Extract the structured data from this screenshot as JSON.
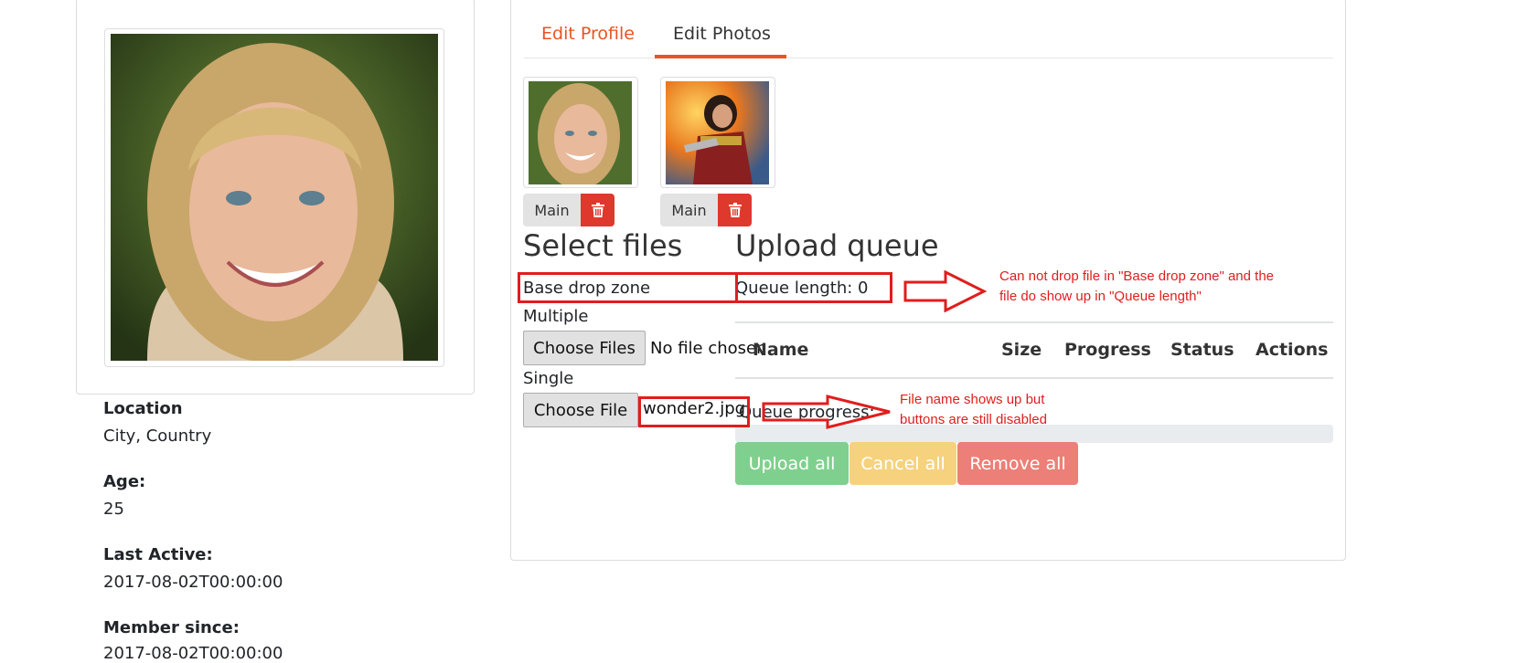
{
  "profile": {
    "location_label": "Location",
    "location_value": "City, Country",
    "age_label": "Age:",
    "age_value": "25",
    "last_active_label": "Last Active:",
    "last_active_value": "2017-08-02T00:00:00",
    "member_since_label": "Member since:",
    "member_since_value": "2017-08-02T00:00:00"
  },
  "tabs": {
    "edit_profile": "Edit Profile",
    "edit_photos": "Edit Photos"
  },
  "photos": [
    {
      "main_label": "Main",
      "delete_icon": "trash-icon"
    },
    {
      "main_label": "Main",
      "delete_icon": "trash-icon"
    }
  ],
  "select_files": {
    "heading": "Select files",
    "drop_zone": "Base drop zone",
    "multiple_label": "Multiple",
    "multiple_button": "Choose Files",
    "multiple_status": "No file chosen",
    "single_label": "Single",
    "single_button": "Choose File",
    "single_status": "wonder2.jpg"
  },
  "upload_queue": {
    "heading": "Upload queue",
    "queue_length": "Queue length: 0",
    "columns": [
      "Name",
      "Size",
      "Progress",
      "Status",
      "Actions"
    ],
    "progress_label": "Queue progress:",
    "progress": 0,
    "upload_all": "Upload all",
    "cancel_all": "Cancel all",
    "remove_all": "Remove all"
  },
  "annotations": {
    "note1_line1": "Can not drop file in \"Base drop zone\" and the",
    "note1_line2": "file do show up in \"Queue length\"",
    "note2_line1": "File name shows up but",
    "note2_line2": "buttons are still disabled"
  },
  "colors": {
    "brand": "#e95420",
    "danger": "#df382c",
    "success_disabled": "#7fd08e",
    "warning_disabled": "#f6d27f",
    "danger_disabled": "#ec7f77",
    "annotation": "#e11d1d"
  }
}
